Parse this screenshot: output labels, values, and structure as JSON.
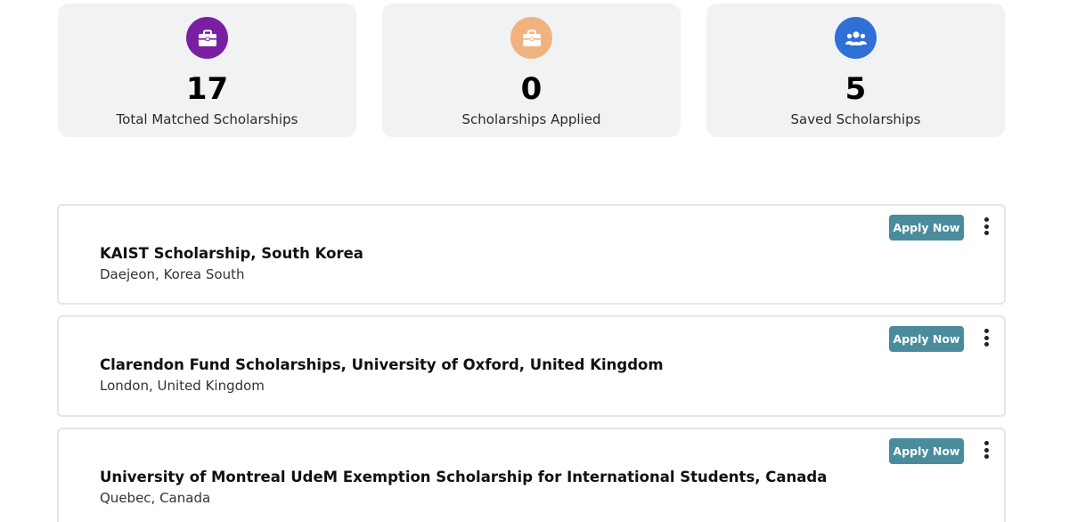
{
  "stats": [
    {
      "value": "17",
      "label": "Total Matched Scholarships",
      "icon": "briefcase-icon",
      "color": "#7b1fa2"
    },
    {
      "value": "0",
      "label": "Scholarships Applied",
      "icon": "briefcase-icon",
      "color": "#f0b27e"
    },
    {
      "value": "5",
      "label": "Saved Scholarships",
      "icon": "users-icon",
      "color": "#2f6fd6"
    }
  ],
  "scholarships": [
    {
      "title": "KAIST Scholarship, South Korea",
      "location": "Daejeon, Korea South",
      "action_label": "Apply Now"
    },
    {
      "title": "Clarendon Fund Scholarships, University of Oxford, United Kingdom",
      "location": "London, United Kingdom",
      "action_label": "Apply Now"
    },
    {
      "title": "University of Montreal UdeM Exemption Scholarship for International Students, Canada",
      "location": "Quebec, Canada",
      "action_label": "Apply Now"
    }
  ],
  "colors": {
    "accent_button": "#4a8c9b",
    "card_background": "#f0f2f3"
  }
}
